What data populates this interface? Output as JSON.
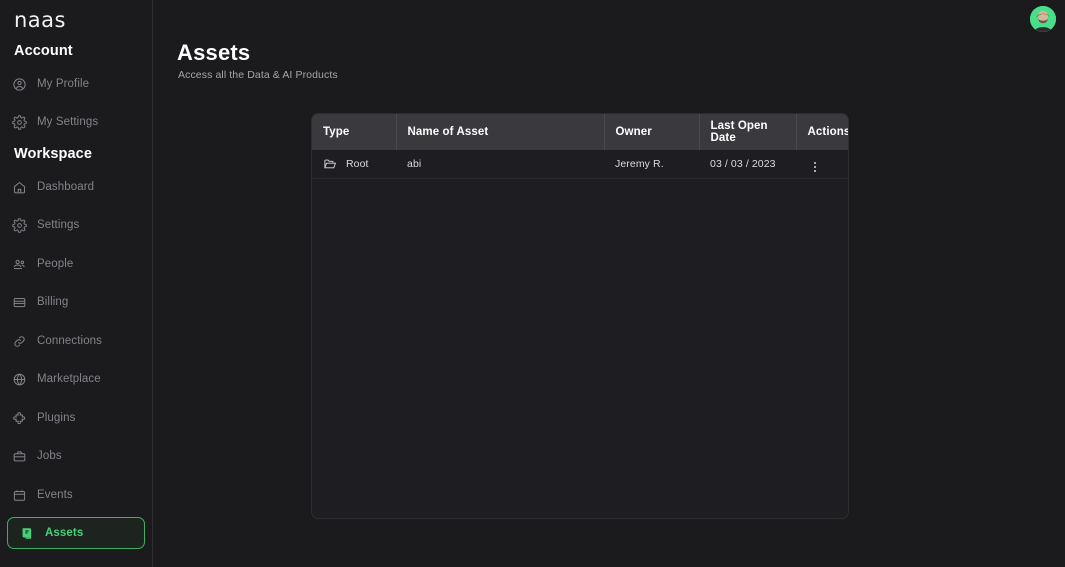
{
  "brand": {
    "logo_text": "naas"
  },
  "sidebar": {
    "sections": [
      {
        "title": "Account",
        "items": [
          {
            "label": "My Profile",
            "icon": "user-circle-icon",
            "active": false
          },
          {
            "label": "My Settings",
            "icon": "gear-icon",
            "active": false
          }
        ]
      },
      {
        "title": "Workspace",
        "items": [
          {
            "label": "Dashboard",
            "icon": "home-icon",
            "active": false
          },
          {
            "label": "Settings",
            "icon": "gear-icon",
            "active": false
          },
          {
            "label": "People",
            "icon": "people-icon",
            "active": false
          },
          {
            "label": "Billing",
            "icon": "credit-card-icon",
            "active": false
          },
          {
            "label": "Connections",
            "icon": "link-icon",
            "active": false
          },
          {
            "label": "Marketplace",
            "icon": "globe-icon",
            "active": false
          },
          {
            "label": "Plugins",
            "icon": "puzzle-icon",
            "active": false
          },
          {
            "label": "Jobs",
            "icon": "briefcase-icon",
            "active": false
          },
          {
            "label": "Events",
            "icon": "calendar-icon",
            "active": false
          },
          {
            "label": "Assets",
            "icon": "document-icon",
            "active": true
          }
        ]
      }
    ]
  },
  "header": {
    "title": "Assets",
    "subtitle": "Access all the  Data & AI Products",
    "avatar_alt": "user-avatar"
  },
  "table": {
    "columns": [
      {
        "key": "type",
        "label": "Type"
      },
      {
        "key": "name",
        "label": "Name of Asset"
      },
      {
        "key": "owner",
        "label": "Owner"
      },
      {
        "key": "date",
        "label": "Last Open Date"
      },
      {
        "key": "actions",
        "label": "Actions"
      }
    ],
    "rows": [
      {
        "type": "Root",
        "type_icon": "folder-open-icon",
        "name": "abi",
        "owner": "Jeremy R.",
        "date": "03 / 03 / 2023",
        "actions_icon": "more-vertical-icon"
      }
    ]
  },
  "colors": {
    "background": "#1b1b1e",
    "sidebar_border": "#2e2e33",
    "accent_green": "#48d178",
    "accent_green_border": "#3fae63",
    "table_header_bg": "#3a3a3e",
    "table_body_bg": "#1e1e22",
    "muted_text": "#83838b"
  }
}
